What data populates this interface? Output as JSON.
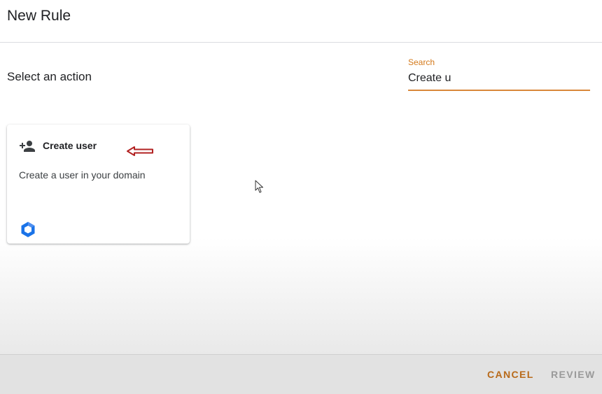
{
  "dialog": {
    "title": "New Rule"
  },
  "section": {
    "title": "Select an action"
  },
  "search": {
    "label": "Search",
    "value": "Create u"
  },
  "card": {
    "title": "Create user",
    "description": "Create a user in your domain",
    "icon": "person-add-icon",
    "product_icon": "google-workspace-hex-icon"
  },
  "footer": {
    "cancel_label": "CANCEL",
    "review_label": "REVIEW"
  },
  "colors": {
    "accent": "#d47a1c",
    "cancel": "#b86a1a",
    "disabled": "#9a9a9a",
    "annotation_arrow": "#b22222",
    "product_blue": "#1a73e8"
  }
}
